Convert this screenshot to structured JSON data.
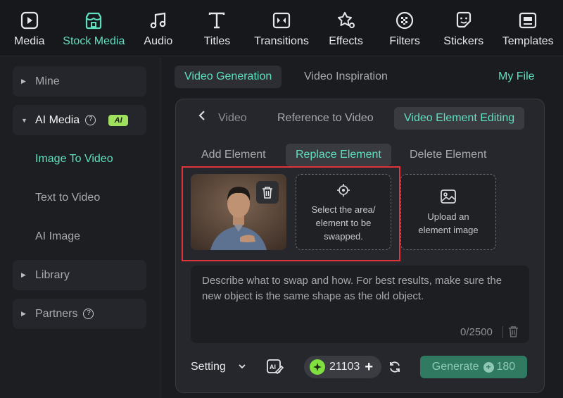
{
  "toolbar": {
    "items": [
      {
        "label": "Media",
        "icon": "media-icon"
      },
      {
        "label": "Stock Media",
        "icon": "stock-media-icon"
      },
      {
        "label": "Audio",
        "icon": "music-note-icon"
      },
      {
        "label": "Titles",
        "icon": "text-t-icon"
      },
      {
        "label": "Transitions",
        "icon": "transition-icon"
      },
      {
        "label": "Effects",
        "icon": "effects-icon"
      },
      {
        "label": "Filters",
        "icon": "filter-icon"
      },
      {
        "label": "Stickers",
        "icon": "sticker-icon"
      },
      {
        "label": "Templates",
        "icon": "templates-icon"
      }
    ],
    "active_index": 1
  },
  "sidebar": {
    "mine": "Mine",
    "ai_media": "AI Media",
    "ai_badge": "AI",
    "sub_items": [
      "Image To Video",
      "Text to Video",
      "AI Image"
    ],
    "library": "Library",
    "partners": "Partners"
  },
  "header": {
    "tab_video_generation": "Video Generation",
    "tab_video_inspiration": "Video Inspiration",
    "my_file": "My File"
  },
  "panel": {
    "tabs": [
      "Video",
      "Reference to Video",
      "Video Element Editing"
    ],
    "element_tabs": [
      "Add Element",
      "Replace Element",
      "Delete Element"
    ],
    "select_area_text": "Select the area/ element to be swapped.",
    "upload_text": "Upload an element image",
    "prompt_placeholder": "Describe what to swap and how. For best results, make sure the new object is the same shape as the old object.",
    "counter": "0/2500",
    "setting": "Setting",
    "credits": "21103",
    "generate_label": "Generate",
    "generate_cost": "180"
  },
  "colors": {
    "accent": "#5ee0c0",
    "highlight_box": "#e0343b",
    "ai_badge": "#9fe05e",
    "generate_bg": "#2f7a61"
  }
}
